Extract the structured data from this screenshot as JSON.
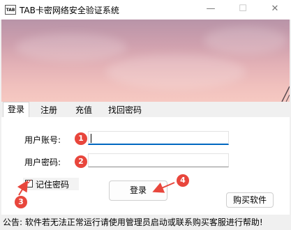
{
  "window": {
    "icon_text": "TAB",
    "title": "TAB卡密网络安全验证系统",
    "minimize_glyph": "—",
    "maximize_glyph": "☐",
    "close_glyph": "✕"
  },
  "tabs": [
    {
      "label": "登录",
      "active": true
    },
    {
      "label": "注册",
      "active": false
    },
    {
      "label": "充值",
      "active": false
    },
    {
      "label": "找回密码",
      "active": false
    }
  ],
  "login": {
    "account_label": "用户账号:",
    "account_value": "",
    "password_label": "用户密码:",
    "password_value": "",
    "remember_label": "记住密码",
    "remember_checked": true,
    "login_button": "登录",
    "buy_button": "购买软件"
  },
  "annotations": [
    "1",
    "2",
    "3",
    "4"
  ],
  "colors": {
    "annotation": "#e8463c",
    "focus_underline": "#0067c0"
  },
  "notice": "公告: 软件若无法正常运行请使用管理员启动或联系购买客服进行帮助!"
}
